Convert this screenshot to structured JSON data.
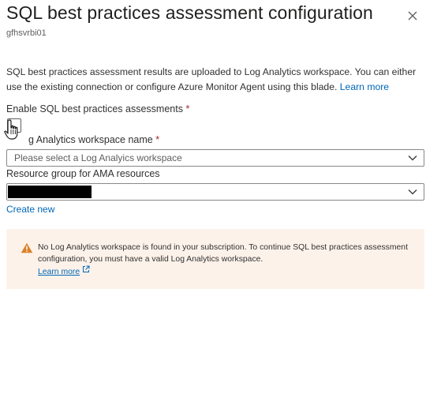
{
  "header": {
    "title": "SQL best practices assessment configuration",
    "subtitle": "gfhsvrbi01"
  },
  "description": {
    "text": "SQL best practices assessment results are uploaded to Log Analytics workspace. You can either use the existing connection or configure Azure Monitor Agent using this blade.",
    "link_label": "Learn more"
  },
  "enable": {
    "label": "Enable SQL best practices assessments",
    "required_mark": "*",
    "checked": false
  },
  "workspace": {
    "label": "g Analytics workspace name",
    "required_mark": "*",
    "placeholder": "Please select a Log Analyics workspace"
  },
  "resource_group": {
    "label": "Resource group for AMA resources",
    "value_redacted": true,
    "create_new_label": "Create new"
  },
  "warning": {
    "text": "No Log Analytics workspace is found in your subscription. To continue SQL best practices assessment configuration, you must have a valid Log Analytics workspace.",
    "link_label": "Learn more"
  },
  "colors": {
    "link": "#0067b8",
    "required": "#a4262c",
    "warning_bg": "#fdf2ea",
    "warning_icon": "#d9822b"
  },
  "icons": {
    "close": "close-icon",
    "chevron": "chevron-down-icon",
    "warning": "warning-icon",
    "external": "external-link-icon",
    "cursor": "hand-cursor-icon"
  }
}
